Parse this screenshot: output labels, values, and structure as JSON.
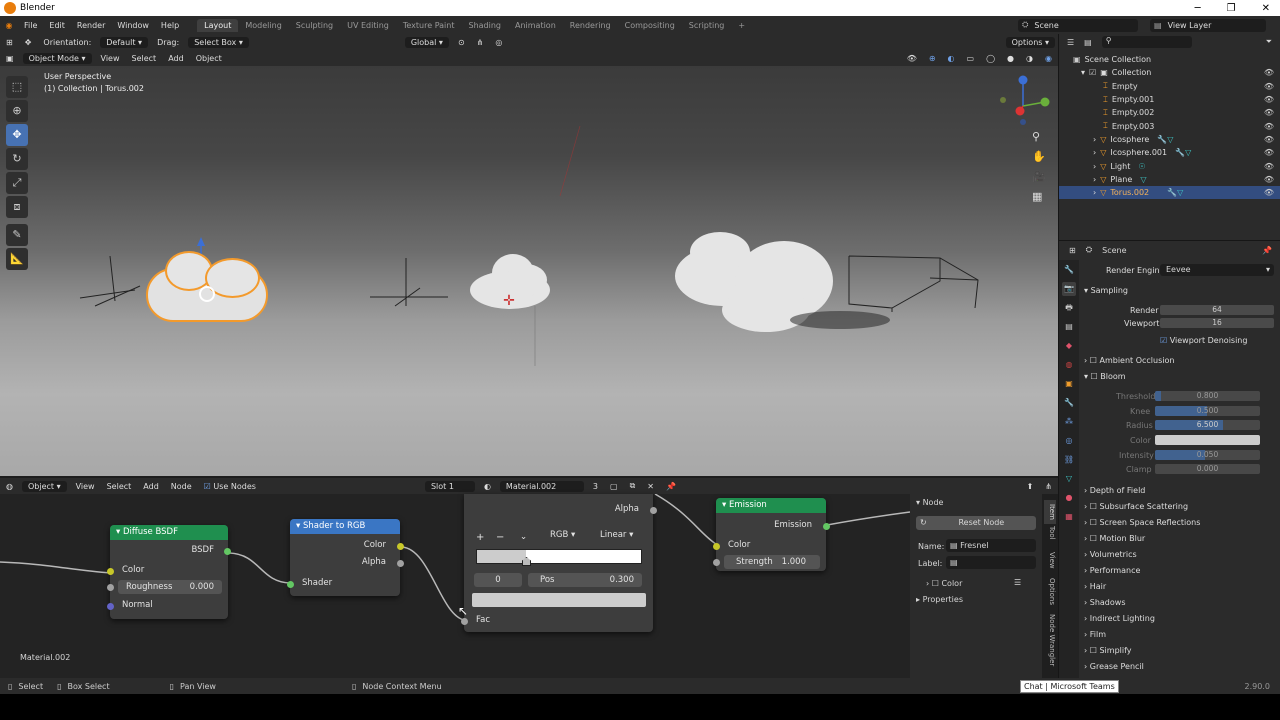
{
  "window": {
    "title": "Blender",
    "min": "─",
    "max": "❐",
    "close": "✕"
  },
  "menu": [
    "File",
    "Edit",
    "Render",
    "Window",
    "Help"
  ],
  "workspaces": [
    "Layout",
    "Modeling",
    "Sculpting",
    "UV Editing",
    "Texture Paint",
    "Shading",
    "Animation",
    "Rendering",
    "Compositing",
    "Scripting"
  ],
  "active_workspace": "Layout",
  "scene_name": "Scene",
  "view_layer": "View Layer",
  "toolbar": {
    "orientation_label": "Orientation:",
    "orientation_value": "Default",
    "drag_label": "Drag:",
    "drag_value": "Select Box",
    "transform": "Global",
    "options": "Options"
  },
  "viewport_header": {
    "mode": "Object Mode",
    "items": [
      "View",
      "Select",
      "Add",
      "Object"
    ]
  },
  "viewport": {
    "perspective": "User Perspective",
    "collection_info": "(1) Collection | Torus.002"
  },
  "outliner": {
    "root": "Scene Collection",
    "collection": "Collection",
    "items": [
      "Empty",
      "Empty.001",
      "Empty.002",
      "Empty.003",
      "Icosphere",
      "Icosphere.001",
      "Light",
      "Plane",
      "Torus.002"
    ],
    "selected": "Torus.002"
  },
  "properties": {
    "scene": "Scene",
    "render_engine_label": "Render Engine",
    "render_engine": "Eevee",
    "sampling": "Sampling",
    "render_label": "Render",
    "render_value": "64",
    "viewport_label": "Viewport",
    "viewport_value": "16",
    "denoise": "Viewport Denoising",
    "sections_top": [
      "Ambient Occlusion",
      "Bloom"
    ],
    "bloom": [
      {
        "label": "Threshold",
        "value": "0.800"
      },
      {
        "label": "Knee",
        "value": "0.500"
      },
      {
        "label": "Radius",
        "value": "6.500"
      },
      {
        "label": "Color",
        "value": ""
      },
      {
        "label": "Intensity",
        "value": "0.050"
      },
      {
        "label": "Clamp",
        "value": "0.000"
      }
    ],
    "sections": [
      "Depth of Field",
      "Subsurface Scattering",
      "Screen Space Reflections",
      "Motion Blur",
      "Volumetrics",
      "Performance",
      "Hair",
      "Shadows",
      "Indirect Lighting",
      "Film",
      "Simplify",
      "Grease Pencil"
    ]
  },
  "node_header": {
    "type": "Object",
    "items": [
      "View",
      "Select",
      "Add",
      "Node"
    ],
    "use_nodes": "Use Nodes",
    "slot": "Slot 1",
    "material": "Material.002",
    "users": "3"
  },
  "nodes": {
    "diffuse": {
      "title": "Diffuse BSDF",
      "out": "BSDF",
      "color": "Color",
      "roughness_label": "Roughness",
      "roughness_value": "0.000",
      "normal": "Normal"
    },
    "shader_to_rgb": {
      "title": "Shader to RGB",
      "color": "Color",
      "alpha": "Alpha",
      "shader": "Shader"
    },
    "color_ramp": {
      "alpha": "Alpha",
      "mode": "RGB",
      "interp": "Linear",
      "index": "0",
      "pos_label": "Pos",
      "pos_value": "0.300",
      "fac": "Fac"
    },
    "emission": {
      "title": "Emission",
      "out": "Emission",
      "color": "Color",
      "strength_label": "Strength",
      "strength_value": "1.000"
    }
  },
  "node_panel": {
    "header": "Node",
    "reset": "Reset Node",
    "name_label": "Name:",
    "name_value": "Fresnel",
    "label_label": "Label:",
    "color": "Color",
    "properties": "Properties"
  },
  "node_tabs": [
    "Item",
    "Tool",
    "View",
    "Options",
    "Node Wrangler"
  ],
  "node_footer": "Material.002",
  "status": {
    "select": "Select",
    "box_select": "Box Select",
    "pan": "Pan View",
    "context": "Node Context Menu",
    "tooltip": "Chat | Microsoft Teams",
    "version": "2.90.0"
  },
  "colors": {
    "accent": "#4772b3",
    "diffuse_header": "#1f8f4f",
    "shader_header": "#3a76c4",
    "emission_header": "#1f8f4f",
    "selected": "#334d80"
  }
}
